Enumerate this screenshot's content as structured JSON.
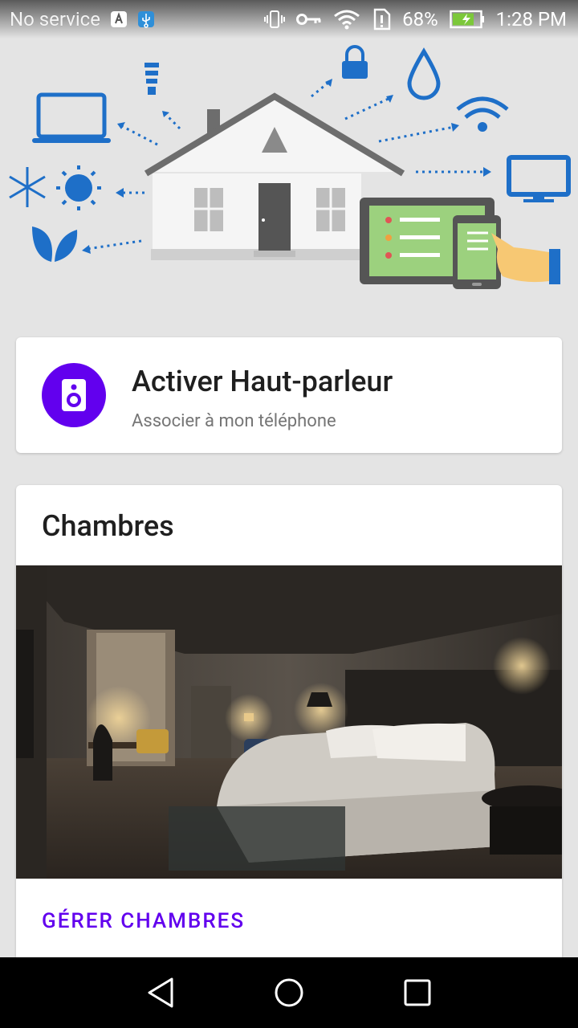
{
  "status_bar": {
    "carrier": "No service",
    "battery": "68%",
    "time": "1:28 PM",
    "icons": [
      "notification-a-icon",
      "usb-icon",
      "vibrate-icon",
      "key-icon",
      "wifi-icon",
      "no-sim-icon",
      "battery-charging-icon"
    ]
  },
  "hero": {
    "illustration": "smart-home-illustration"
  },
  "speaker_card": {
    "icon": "speaker-icon",
    "title": "Activer Haut-parleur",
    "subtitle": "Associer à mon téléphone"
  },
  "rooms_card": {
    "title": "Chambres",
    "image": "bedroom-photo",
    "action_label": "GÉRER CHAMBRES"
  },
  "nav_bar": {
    "back": "back-icon",
    "home": "home-icon",
    "recents": "recents-icon"
  },
  "colors": {
    "accent": "#6200ee",
    "illustration_blue": "#1e6fc8",
    "background": "#e4e4e4"
  }
}
